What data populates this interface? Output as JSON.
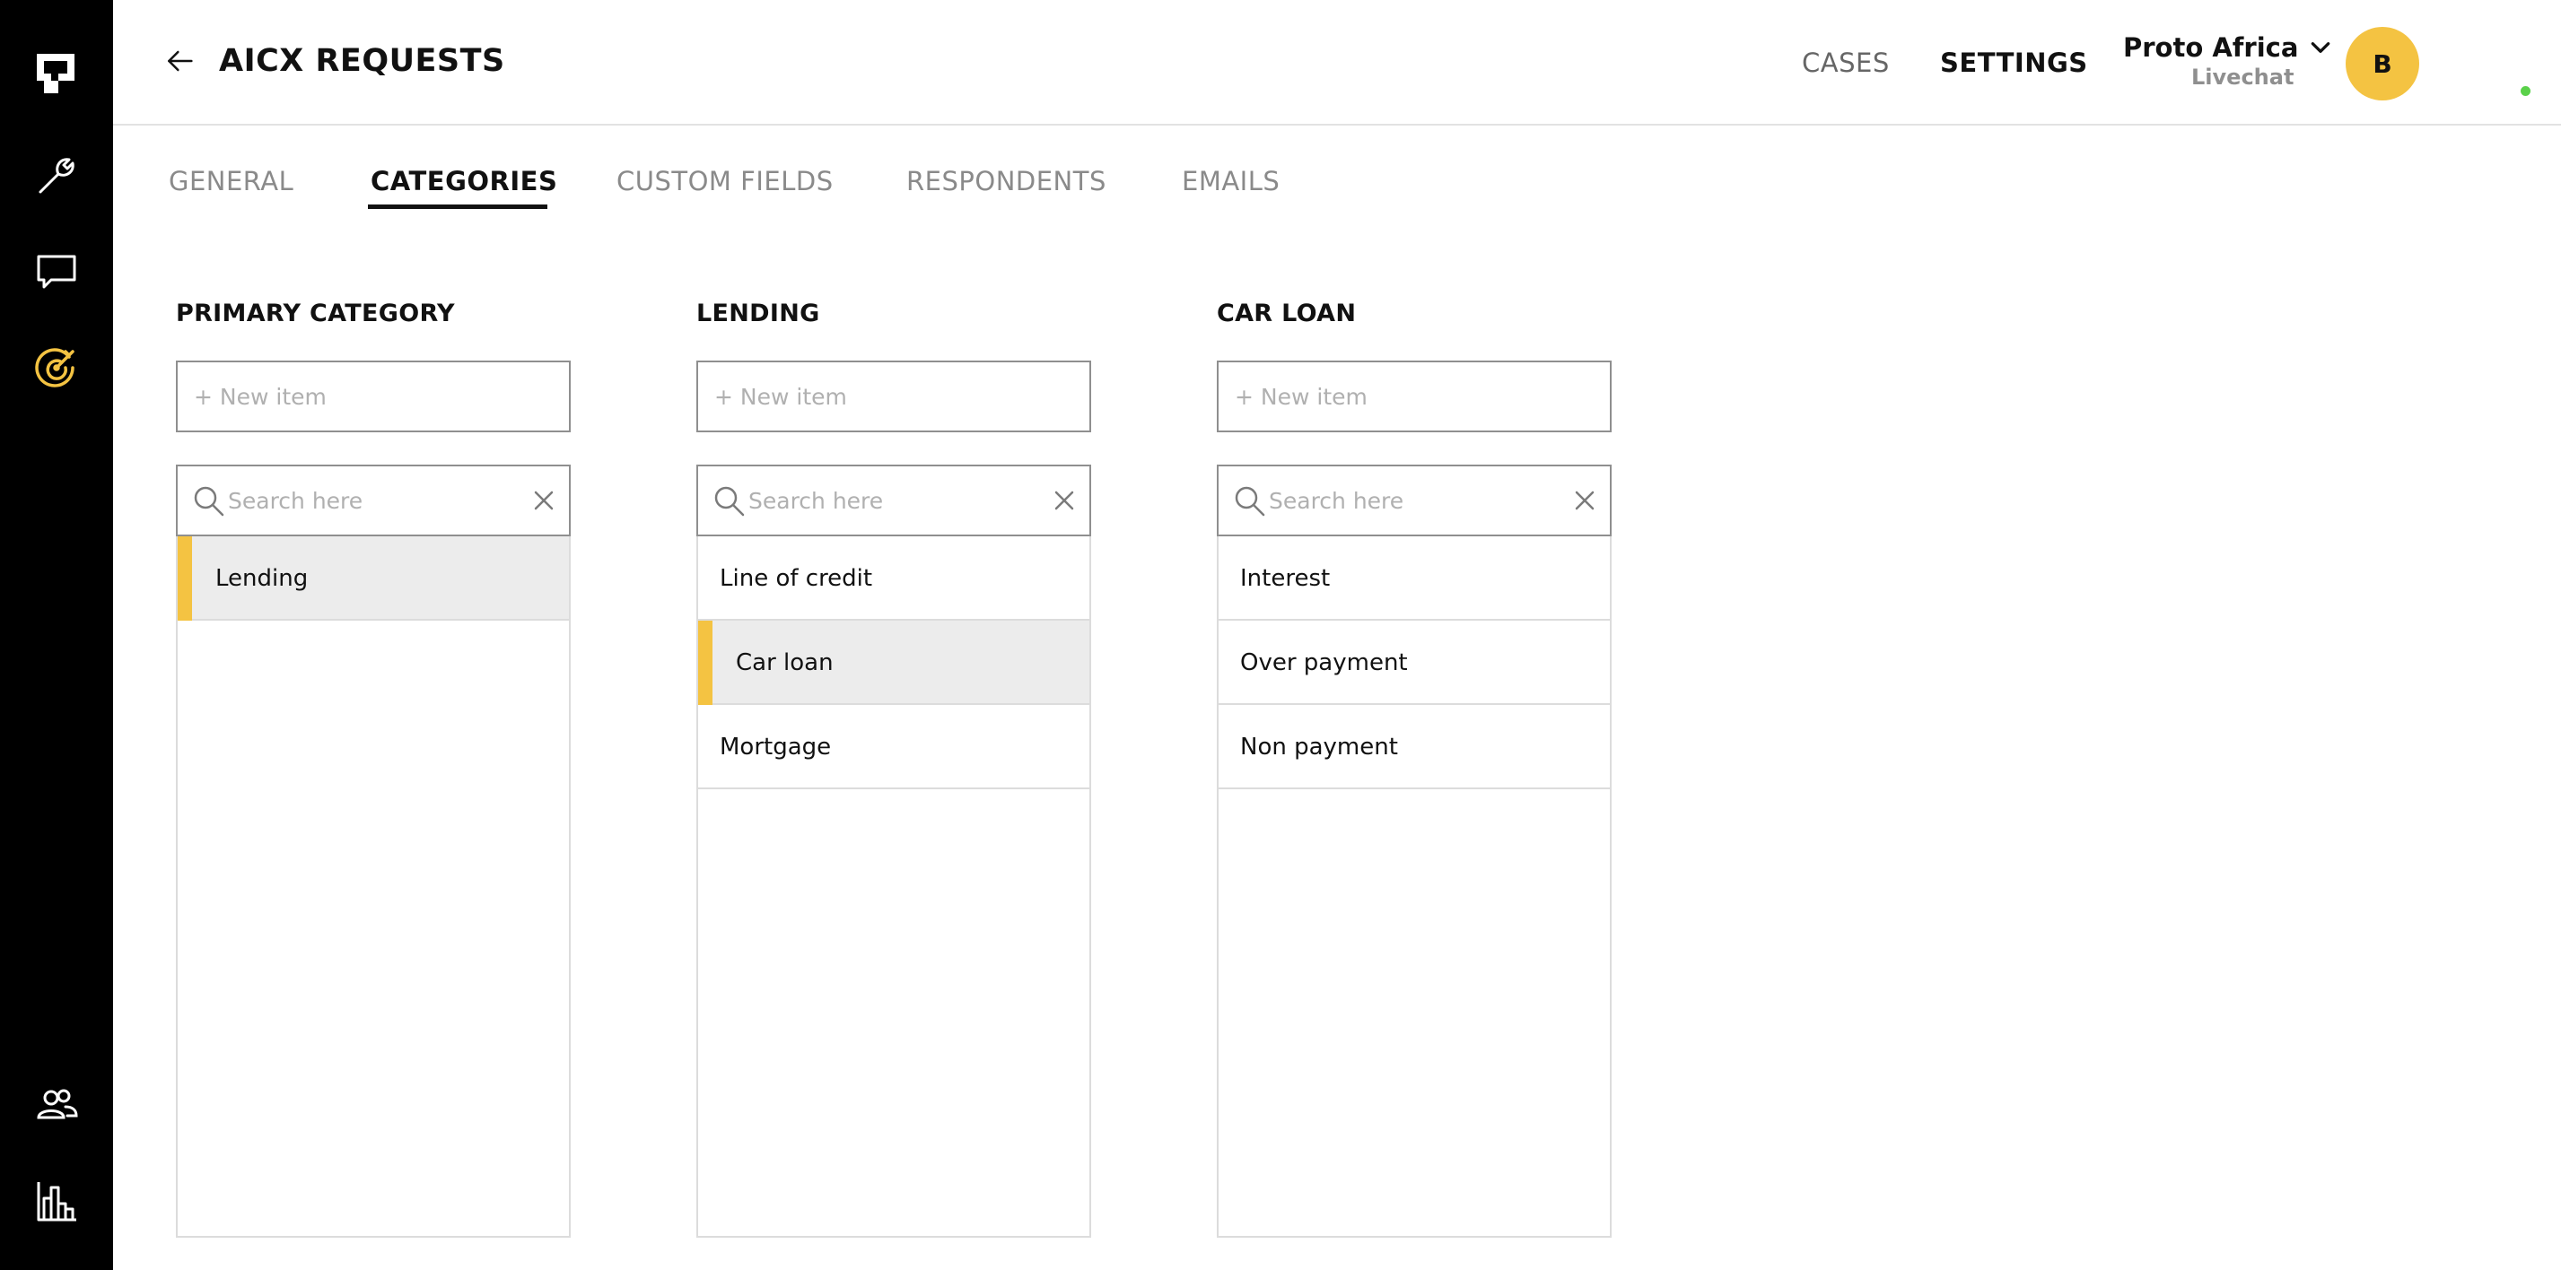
{
  "app": {
    "title": "AICX REQUESTS",
    "accent_color": "#f4c342",
    "rail_color": "#000000"
  },
  "rail": {
    "items": [
      {
        "icon": "logo-icon",
        "active": false
      },
      {
        "icon": "wrench-icon",
        "active": false
      },
      {
        "icon": "chat-bubble-icon",
        "active": false
      },
      {
        "icon": "target-icon",
        "active": true
      },
      {
        "icon": "users-icon",
        "active": false
      },
      {
        "icon": "bar-chart-icon",
        "active": false
      }
    ]
  },
  "header": {
    "nav_cases": "CASES",
    "nav_settings": "SETTINGS",
    "account_name": "Proto Africa",
    "account_sub": "Livechat",
    "avatar_initial": "B",
    "presence_color": "#5ad14a"
  },
  "tabs": [
    {
      "label": "GENERAL",
      "active": false
    },
    {
      "label": "CATEGORIES",
      "active": true
    },
    {
      "label": "CUSTOM FIELDS",
      "active": false
    },
    {
      "label": "RESPONDENTS",
      "active": false
    },
    {
      "label": "EMAILS",
      "active": false
    }
  ],
  "columns": [
    {
      "title": "PRIMARY CATEGORY",
      "new_item_placeholder": "+ New item",
      "search_placeholder": "Search here",
      "items": [
        {
          "label": "Lending",
          "selected": true
        }
      ]
    },
    {
      "title": "LENDING",
      "new_item_placeholder": "+ New item",
      "search_placeholder": "Search here",
      "items": [
        {
          "label": "Line of credit",
          "selected": false
        },
        {
          "label": "Car loan",
          "selected": true
        },
        {
          "label": "Mortgage",
          "selected": false
        }
      ]
    },
    {
      "title": "CAR LOAN",
      "new_item_placeholder": "+ New item",
      "search_placeholder": "Search here",
      "items": [
        {
          "label": "Interest",
          "selected": false
        },
        {
          "label": "Over payment",
          "selected": false
        },
        {
          "label": "Non payment",
          "selected": false
        }
      ]
    }
  ]
}
